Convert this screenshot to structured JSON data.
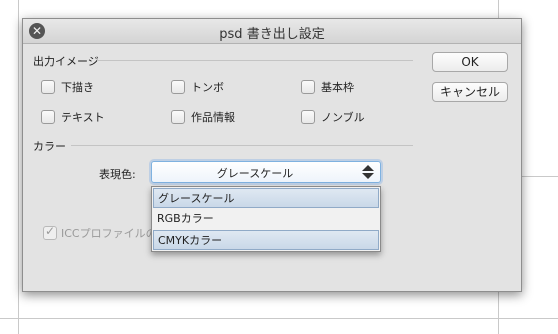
{
  "dialog": {
    "title": "psd 書き出し設定",
    "close_icon": "close-icon"
  },
  "output_image": {
    "section_label": "出力イメージ",
    "checkboxes": [
      {
        "label": "下描き",
        "checked": false
      },
      {
        "label": "トンボ",
        "checked": false
      },
      {
        "label": "基本枠",
        "checked": false
      },
      {
        "label": "テキスト",
        "checked": false
      },
      {
        "label": "作品情報",
        "checked": false
      },
      {
        "label": "ノンブル",
        "checked": false
      }
    ]
  },
  "buttons": {
    "ok": "OK",
    "cancel": "キャンセル"
  },
  "color": {
    "section_label": "カラー",
    "expression_label": "表現色:",
    "selected_value": "グレースケール",
    "options": [
      "グレースケール",
      "RGBカラー",
      "CMYKカラー"
    ],
    "icc_label": "ICCプロファイルの",
    "icc_checked": true
  },
  "colors": {
    "dialog_bg": "#e3e3e3",
    "focus_ring": "#7fb2e0",
    "highlight": "#c9d8e8"
  }
}
